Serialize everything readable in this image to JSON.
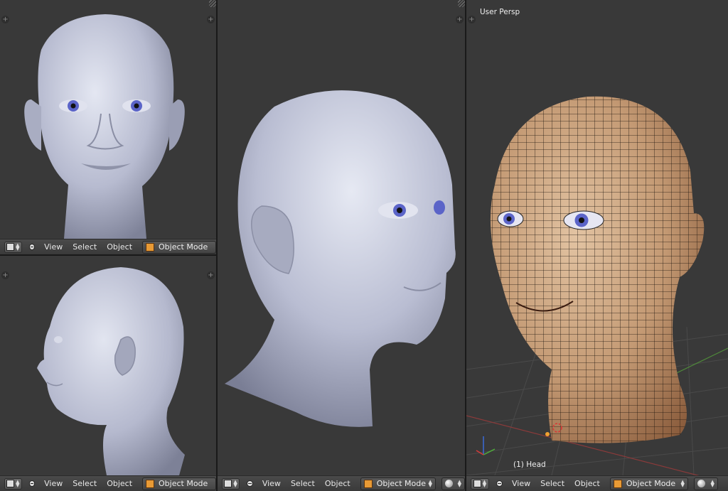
{
  "viewports": {
    "front": {
      "menu": [
        "View",
        "Select",
        "Object"
      ],
      "mode": "Object Mode"
    },
    "side": {
      "menu": [
        "View",
        "Select",
        "Object"
      ],
      "mode": "Object Mode"
    },
    "center": {
      "menu": [
        "View",
        "Select",
        "Object"
      ],
      "mode": "Object Mode"
    },
    "persp": {
      "title": "User Persp",
      "object_label": "(1) Head",
      "menu": [
        "View",
        "Select",
        "Object"
      ],
      "mode": "Object Mode"
    }
  },
  "icons": {
    "editor_type": "3d-view-cube-icon",
    "collapse": "collapse-minus-icon",
    "object_mode": "object-cube-icon",
    "shading": "solid-sphere-icon",
    "add_region": "plus-icon"
  },
  "colors": {
    "viewport_bg": "#393939",
    "header_bg": "#444444",
    "skin_clay": "#b9bdcf",
    "skin_textured": "#c8a27f",
    "eye_iris": "#5b64c8"
  }
}
